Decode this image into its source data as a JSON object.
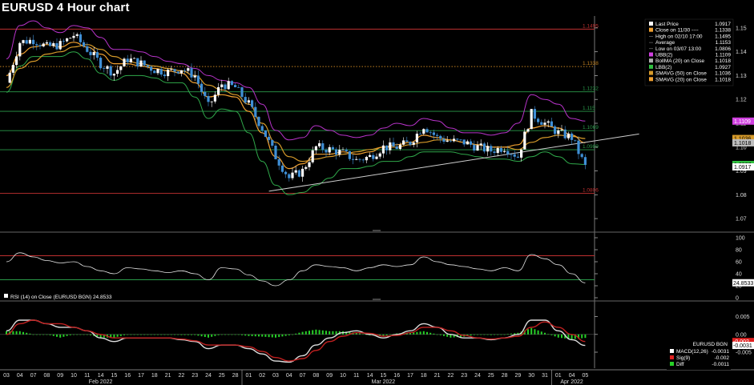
{
  "window": {
    "title": "EURUSD 4 Hour chart"
  },
  "colors": {
    "background": "#000000",
    "candle_up": "#ffffff",
    "candle_down": "#3f8fd6",
    "upper_band": "#b733c9",
    "lower_band": "#2fa84a",
    "boll_ma": "#c8c8c8",
    "smavg50": "#d69a2a",
    "smavg20": "#f0a030",
    "support_line": "#cfcfcf",
    "rsi_line": "#e6e6e6",
    "macd_fill_up": "#bdbdbd",
    "macd_fill_down": "#c02020",
    "histogram": "#27d027"
  },
  "legend": {
    "items": [
      {
        "label": "Last Price",
        "value": "1.0917",
        "color": "#ffffff"
      },
      {
        "label": "Close on 11/30 ----",
        "value": "1.1338",
        "color": "#f0a030"
      },
      {
        "label": "High on 02/10 17:00",
        "value": "1.1495",
        "color": ""
      },
      {
        "label": "Average",
        "value": "1.1153",
        "color": ""
      },
      {
        "label": "Low on 03/07 13:00",
        "value": "1.0806",
        "color": ""
      },
      {
        "label": "UBB(2)",
        "value": "1.1109",
        "color": "#d040e0"
      },
      {
        "label": "BollMA (20) on Close",
        "value": "1.1018",
        "color": "#b0b0b0"
      },
      {
        "label": "LBB(2)",
        "value": "1.0927",
        "color": "#30c040"
      },
      {
        "label": "SMAVG (50) on Close",
        "value": "1.1036",
        "color": "#d69a2a"
      },
      {
        "label": "SMAVG (20) on Close",
        "value": "1.1018",
        "color": "#f0a030"
      }
    ]
  },
  "price_levels": [
    {
      "value": 1.1495,
      "label": "1.1495",
      "color": "#c03030"
    },
    {
      "value": 1.1338,
      "label": "1.1338",
      "color": "#c08020",
      "dotted": true
    },
    {
      "value": 1.1232,
      "label": "1.1232",
      "color": "#2a9a4a"
    },
    {
      "value": 1.115,
      "label": "1.115",
      "color": "#2a9a4a"
    },
    {
      "value": 1.1069,
      "label": "1.1069",
      "color": "#2a9a4a"
    },
    {
      "value": 1.0989,
      "label": "1.0989",
      "color": "#2a9a4a"
    },
    {
      "value": 1.0806,
      "label": "1.0806",
      "color": "#c03030"
    }
  ],
  "price_axis": {
    "ticks": [
      "1.15",
      "1.14",
      "1.13",
      "1.12",
      "1.11",
      "1.10",
      "1.09",
      "1.08",
      "1.07"
    ],
    "badges": [
      {
        "label": "1.1109",
        "value": 1.1109,
        "bg": "#d040e0",
        "fg": "#ffffff"
      },
      {
        "label": "1.1036",
        "value": 1.1036,
        "bg": "#d69a2a",
        "fg": "#000000"
      },
      {
        "label": "1.1018",
        "value": 1.1018,
        "bg": "#bdbdbd",
        "fg": "#000000"
      },
      {
        "label": "1.0927",
        "value": 1.0927,
        "bg": "#30c040",
        "fg": "#000000"
      },
      {
        "label": "1.0917",
        "value": 1.0917,
        "bg": "#ffffff",
        "fg": "#000000"
      }
    ]
  },
  "rsi_panel": {
    "legend": "RSI (14)  on Close (EURUSD BGN) 24.8533",
    "ticks": [
      "100",
      "80",
      "60",
      "40",
      "20",
      "0"
    ],
    "levels": [
      70,
      30
    ],
    "last_badge": "24.8533"
  },
  "macd_panel": {
    "ticks": [
      "0.005",
      "0.00",
      "-0.005"
    ],
    "legend_title": "EURUSD BGN",
    "legend_items": [
      {
        "label": "MACD(12,26)",
        "value": "-0.0031",
        "color": "#ffffff"
      },
      {
        "label": "Sig(9)",
        "value": "-0.002",
        "color": "#e02020"
      },
      {
        "label": "Diff",
        "value": "-0.0011",
        "color": "#27d027"
      }
    ],
    "badges": [
      {
        "label": "-0.002",
        "value": -0.002,
        "bg": "#e02020",
        "fg": "#ffffff"
      },
      {
        "label": "-0.0031",
        "value": -0.0031,
        "bg": "#ffffff",
        "fg": "#000000"
      }
    ]
  },
  "x_axis": {
    "days": [
      "03",
      "04",
      "07",
      "08",
      "09",
      "10",
      "11",
      "14",
      "15",
      "16",
      "17",
      "18",
      "21",
      "22",
      "23",
      "24",
      "25",
      "28",
      "01",
      "02",
      "03",
      "04",
      "07",
      "08",
      "09",
      "10",
      "11",
      "14",
      "15",
      "16",
      "17",
      "18",
      "21",
      "22",
      "23",
      "24",
      "25",
      "28",
      "29",
      "30",
      "31",
      "01",
      "04",
      "05"
    ],
    "months": [
      {
        "label": "Feb 2022",
        "day_index": 7
      },
      {
        "label": "Mar 2022",
        "day_index": 28
      },
      {
        "label": "Apr 2022",
        "day_index": 42
      }
    ]
  },
  "chart_data": {
    "type": "candlestick",
    "title": "EURUSD 4 Hour chart",
    "ylim": [
      1.065,
      1.155
    ],
    "anchors_day_index": [
      0,
      1,
      2,
      3,
      4,
      5,
      6,
      7,
      8,
      9,
      10,
      11,
      12,
      13,
      14,
      15,
      16,
      17,
      18,
      19,
      20,
      21,
      22,
      23,
      24,
      25,
      26,
      27,
      28,
      29,
      30,
      31,
      32,
      33,
      34,
      35,
      36,
      37,
      38,
      39,
      40,
      41,
      42,
      43
    ],
    "price_close": [
      1.127,
      1.144,
      1.145,
      1.142,
      1.143,
      1.147,
      1.141,
      1.135,
      1.131,
      1.137,
      1.135,
      1.1325,
      1.1315,
      1.133,
      1.13,
      1.117,
      1.1265,
      1.125,
      1.118,
      1.108,
      1.096,
      1.087,
      1.09,
      1.1,
      1.099,
      1.0975,
      1.0945,
      1.096,
      1.1,
      1.1,
      1.102,
      1.109,
      1.104,
      1.1025,
      1.102,
      1.1,
      1.0985,
      1.1,
      1.096,
      1.114,
      1.11,
      1.106,
      1.104,
      1.0917
    ],
    "upper_band": [
      1.137,
      1.151,
      1.153,
      1.15,
      1.148,
      1.151,
      1.15,
      1.146,
      1.141,
      1.141,
      1.14,
      1.138,
      1.136,
      1.135,
      1.133,
      1.13,
      1.128,
      1.127,
      1.125,
      1.118,
      1.107,
      1.103,
      1.104,
      1.109,
      1.107,
      1.105,
      1.104,
      1.105,
      1.108,
      1.11,
      1.109,
      1.112,
      1.111,
      1.108,
      1.106,
      1.106,
      1.105,
      1.106,
      1.11,
      1.122,
      1.12,
      1.118,
      1.112,
      1.1109
    ],
    "lower_band": [
      1.123,
      1.134,
      1.138,
      1.138,
      1.138,
      1.14,
      1.137,
      1.131,
      1.128,
      1.13,
      1.13,
      1.129,
      1.127,
      1.127,
      1.121,
      1.112,
      1.116,
      1.115,
      1.106,
      1.094,
      1.084,
      1.08,
      1.081,
      1.084,
      1.087,
      1.091,
      1.091,
      1.092,
      1.094,
      1.094,
      1.096,
      1.098,
      1.098,
      1.098,
      1.097,
      1.096,
      1.095,
      1.095,
      1.094,
      1.096,
      1.098,
      1.096,
      1.093,
      1.0927
    ],
    "smavg50": [
      1.125,
      1.133,
      1.136,
      1.139,
      1.14,
      1.142,
      1.143,
      1.141,
      1.138,
      1.136,
      1.135,
      1.134,
      1.133,
      1.132,
      1.13,
      1.126,
      1.124,
      1.122,
      1.118,
      1.11,
      1.102,
      1.096,
      1.094,
      1.095,
      1.096,
      1.097,
      1.098,
      1.099,
      1.1,
      1.1,
      1.101,
      1.102,
      1.103,
      1.103,
      1.102,
      1.101,
      1.1,
      1.1,
      1.099,
      1.102,
      1.104,
      1.105,
      1.1045,
      1.1036
    ],
    "smavg20": [
      1.13,
      1.139,
      1.142,
      1.143,
      1.142,
      1.144,
      1.142,
      1.139,
      1.135,
      1.135,
      1.134,
      1.133,
      1.132,
      1.131,
      1.127,
      1.121,
      1.122,
      1.121,
      1.115,
      1.106,
      1.096,
      1.091,
      1.093,
      1.097,
      1.097,
      1.098,
      1.097,
      1.098,
      1.1,
      1.101,
      1.102,
      1.105,
      1.104,
      1.103,
      1.102,
      1.101,
      1.1,
      1.1,
      1.101,
      1.108,
      1.109,
      1.108,
      1.105,
      1.1018
    ],
    "support_line": {
      "from": {
        "day_index": 19.5,
        "price": 1.0815
      },
      "to": {
        "day_index": 47,
        "price": 1.1055
      }
    },
    "rsi": [
      60,
      75,
      68,
      62,
      58,
      60,
      52,
      45,
      40,
      50,
      48,
      45,
      42,
      45,
      40,
      30,
      50,
      48,
      38,
      28,
      20,
      30,
      45,
      55,
      52,
      50,
      45,
      50,
      55,
      52,
      55,
      68,
      60,
      55,
      52,
      48,
      45,
      50,
      45,
      72,
      65,
      55,
      40,
      25
    ],
    "macd": [
      0.001,
      0.004,
      0.004,
      0.003,
      0.002,
      0.002,
      0.001,
      -0.001,
      -0.002,
      -0.001,
      -0.001,
      -0.001,
      -0.001,
      -0.0015,
      -0.002,
      -0.004,
      -0.003,
      -0.003,
      -0.004,
      -0.0055,
      -0.0075,
      -0.0078,
      -0.006,
      -0.003,
      -0.001,
      0.0005,
      0.001,
      0.0,
      -0.001,
      0.0,
      0.001,
      0.003,
      0.002,
      0.0,
      -0.001,
      -0.001,
      -0.0015,
      -0.001,
      0.0,
      0.004,
      0.004,
      0.001,
      -0.0015,
      -0.0031
    ],
    "macd_signal": [
      0.0,
      0.003,
      0.004,
      0.003,
      0.003,
      0.002,
      0.001,
      0.0,
      -0.001,
      -0.001,
      -0.001,
      -0.001,
      -0.001,
      -0.0013,
      -0.0018,
      -0.003,
      -0.003,
      -0.003,
      -0.0035,
      -0.0048,
      -0.0065,
      -0.0075,
      -0.0068,
      -0.0045,
      -0.002,
      -0.0005,
      0.0005,
      0.0003,
      -0.0005,
      -0.0003,
      0.0005,
      0.002,
      0.002,
      0.001,
      -0.0003,
      -0.001,
      -0.0013,
      -0.001,
      -0.0005,
      0.002,
      0.0035,
      0.002,
      0.0,
      -0.002
    ]
  }
}
